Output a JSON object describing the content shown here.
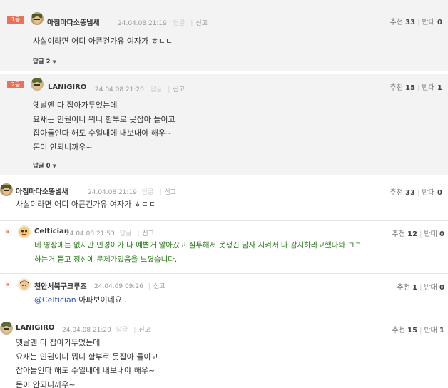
{
  "best_comments": [
    {
      "rank": "1등",
      "nick": "아침마다소똥냄새",
      "date": "24.04.08 21:19",
      "reply_label": "답글",
      "report_label": "신고",
      "up_label": "추천",
      "up": "33",
      "down_label": "반대",
      "down": "0",
      "lines": [
        "사실이라면 어디 아픈건가유 여자가 ㅎㄷㄷ"
      ],
      "replies_label": "답글 2"
    },
    {
      "rank": "2등",
      "nick": "LANIGIRO",
      "date": "24.04.08 21:20",
      "reply_label": "답글",
      "report_label": "신고",
      "up_label": "추천",
      "up": "15",
      "down_label": "반대",
      "down": "1",
      "lines": [
        "옛날엔 다 잡아가두었는데",
        "요새는 인권이니 뭐니 함부로 못잡아 들이고",
        "잡아들인다 해도 수일내에 내보내야 해우~",
        "돈이 안되니까우~"
      ],
      "replies_label": "답글 0"
    }
  ],
  "comments": [
    {
      "nick": "아침마다소똥냄새",
      "date": "24.04.08 21:19",
      "reply_label": "답글",
      "report_label": "신고",
      "up_label": "추천",
      "up": "33",
      "down_label": "반대",
      "down": "0",
      "lines": [
        "사실이라면 어디 아픈건가유 여자가 ㅎㄷㄷ"
      ]
    },
    {
      "reply_arrow": "↳",
      "nick": "Celtician",
      "date": "24.04.08 21:53",
      "reply_label": "답글",
      "report_label": "신고",
      "up_label": "추천",
      "up": "12",
      "down_label": "반대",
      "down": "0",
      "lines": [
        "네 영상에는 없지만 민경이가 나 예쁜거 알아갔고 질투해서 못생긴 남자 시켜서 나 감시하라고했나봐 ㅋㅋ",
        "하는거 듣고 정신에 문제가있음을 느꼈습니다."
      ]
    },
    {
      "reply_arrow": "↳",
      "nick": "천안서북구크루즈",
      "date": "24.04.09 09:26",
      "report_label": "신고",
      "up_label": "추천",
      "up": "1",
      "down_label": "반대",
      "down": "0",
      "mention": "@Celtician",
      "text_after_mention": " 아파보이네요.."
    },
    {
      "nick": "LANIGIRO",
      "date": "24.04.08 21:20",
      "reply_label": "답글",
      "report_label": "신고",
      "up_label": "추천",
      "up": "15",
      "down_label": "반대",
      "down": "1",
      "lines": [
        "옛날엔 다 잡아가두었는데",
        "요새는 인권이니 뭐니 함부로 못잡아 들이고",
        "잡아들인다 해도 수일내에 내보내야 해우~",
        "돈이 안되니까우~"
      ]
    }
  ],
  "icons": {
    "avatar_1": "soldier-avatar-icon",
    "avatar_2": "military-cap-avatar-icon",
    "avatar_3": "robot-avatar-icon",
    "avatar_4": "brown-hair-avatar-icon",
    "reply_arrow": "reply-arrow-icon",
    "caret": "caret-down-icon"
  },
  "colors": {
    "rank_badge": "#e9735a",
    "best_bg": "#f3f3f3",
    "reply_text_green": "#2a7a1a",
    "mention_blue": "#3355bb"
  }
}
